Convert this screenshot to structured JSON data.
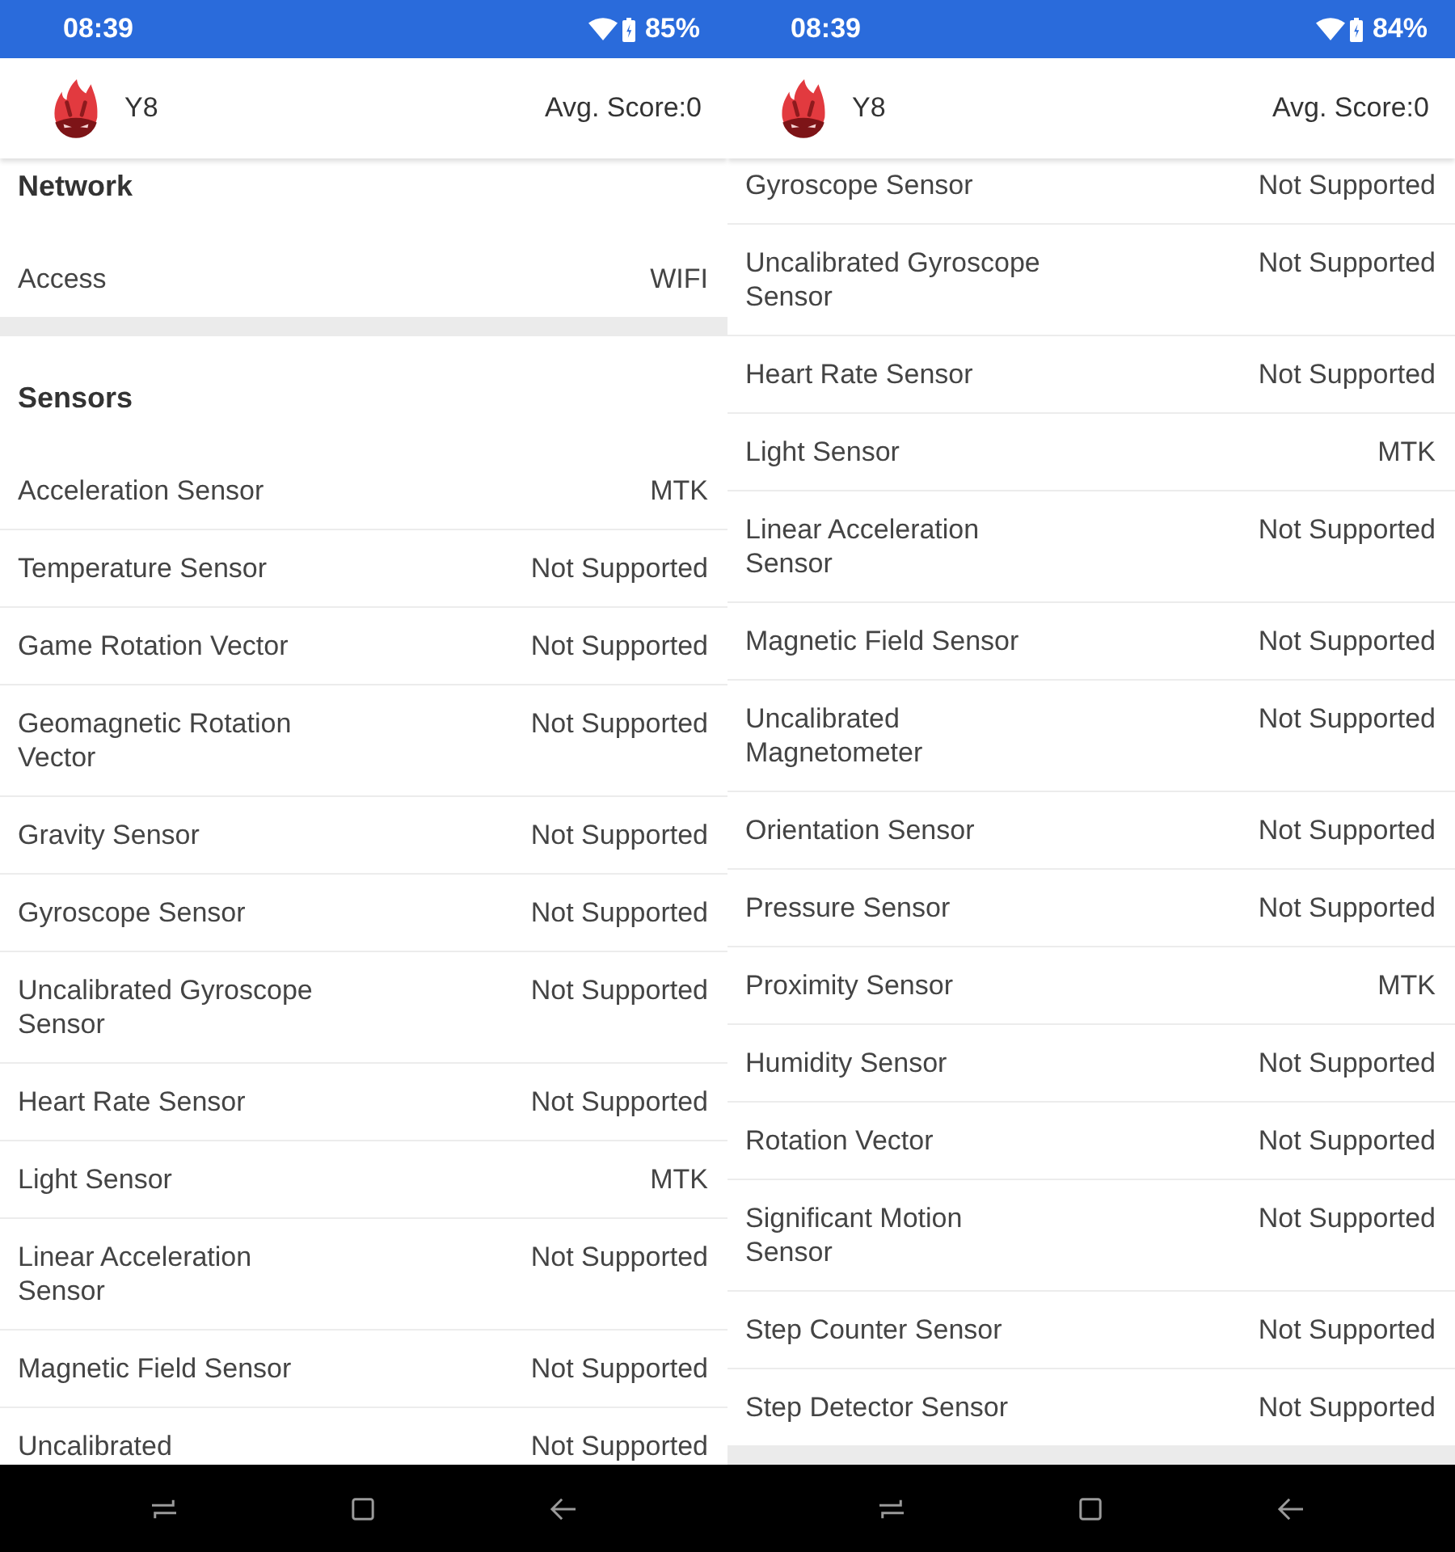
{
  "screens": [
    {
      "status_bar": {
        "time": "08:39",
        "battery": "85%"
      },
      "header": {
        "device": "Y8",
        "score": "Avg. Score:0"
      },
      "sections": [
        {
          "title": "Network",
          "rows": [
            {
              "label": "Access",
              "value": "WIFI"
            }
          ]
        },
        {
          "title": "Sensors",
          "rows": [
            {
              "label": "Acceleration Sensor",
              "value": "MTK"
            },
            {
              "label": "Temperature Sensor",
              "value": "Not Supported"
            },
            {
              "label": "Game Rotation Vector",
              "value": "Not Supported"
            },
            {
              "label": "Geomagnetic Rotation Vector",
              "value": "Not Supported"
            },
            {
              "label": "Gravity Sensor",
              "value": "Not Supported"
            },
            {
              "label": "Gyroscope Sensor",
              "value": "Not Supported"
            },
            {
              "label": "Uncalibrated Gyroscope Sensor",
              "value": "Not Supported"
            },
            {
              "label": "Heart Rate Sensor",
              "value": "Not Supported"
            },
            {
              "label": "Light Sensor",
              "value": "MTK"
            },
            {
              "label": "Linear Acceleration Sensor",
              "value": "Not Supported"
            },
            {
              "label": "Magnetic Field Sensor",
              "value": "Not Supported"
            },
            {
              "label": "Uncalibrated",
              "value": "Not Supported"
            }
          ]
        }
      ]
    },
    {
      "status_bar": {
        "time": "08:39",
        "battery": "84%"
      },
      "header": {
        "device": "Y8",
        "score": "Avg. Score:0"
      },
      "sections": [
        {
          "rows": [
            {
              "label": "Gyroscope Sensor",
              "value": "Not Supported"
            },
            {
              "label": "Uncalibrated Gyroscope Sensor",
              "value": "Not Supported"
            },
            {
              "label": "Heart Rate Sensor",
              "value": "Not Supported"
            },
            {
              "label": "Light Sensor",
              "value": "MTK"
            },
            {
              "label": "Linear Acceleration Sensor",
              "value": "Not Supported"
            },
            {
              "label": "Magnetic Field Sensor",
              "value": "Not Supported"
            },
            {
              "label": "Uncalibrated Magnetometer",
              "value": "Not Supported"
            },
            {
              "label": "Orientation Sensor",
              "value": "Not Supported"
            },
            {
              "label": "Pressure Sensor",
              "value": "Not Supported"
            },
            {
              "label": "Proximity Sensor",
              "value": "MTK"
            },
            {
              "label": "Humidity Sensor",
              "value": "Not Supported"
            },
            {
              "label": "Rotation Vector",
              "value": "Not Supported"
            },
            {
              "label": "Significant Motion Sensor",
              "value": "Not Supported"
            },
            {
              "label": "Step Counter Sensor",
              "value": "Not Supported"
            },
            {
              "label": "Step Detector Sensor",
              "value": "Not Supported"
            }
          ]
        }
      ]
    }
  ]
}
